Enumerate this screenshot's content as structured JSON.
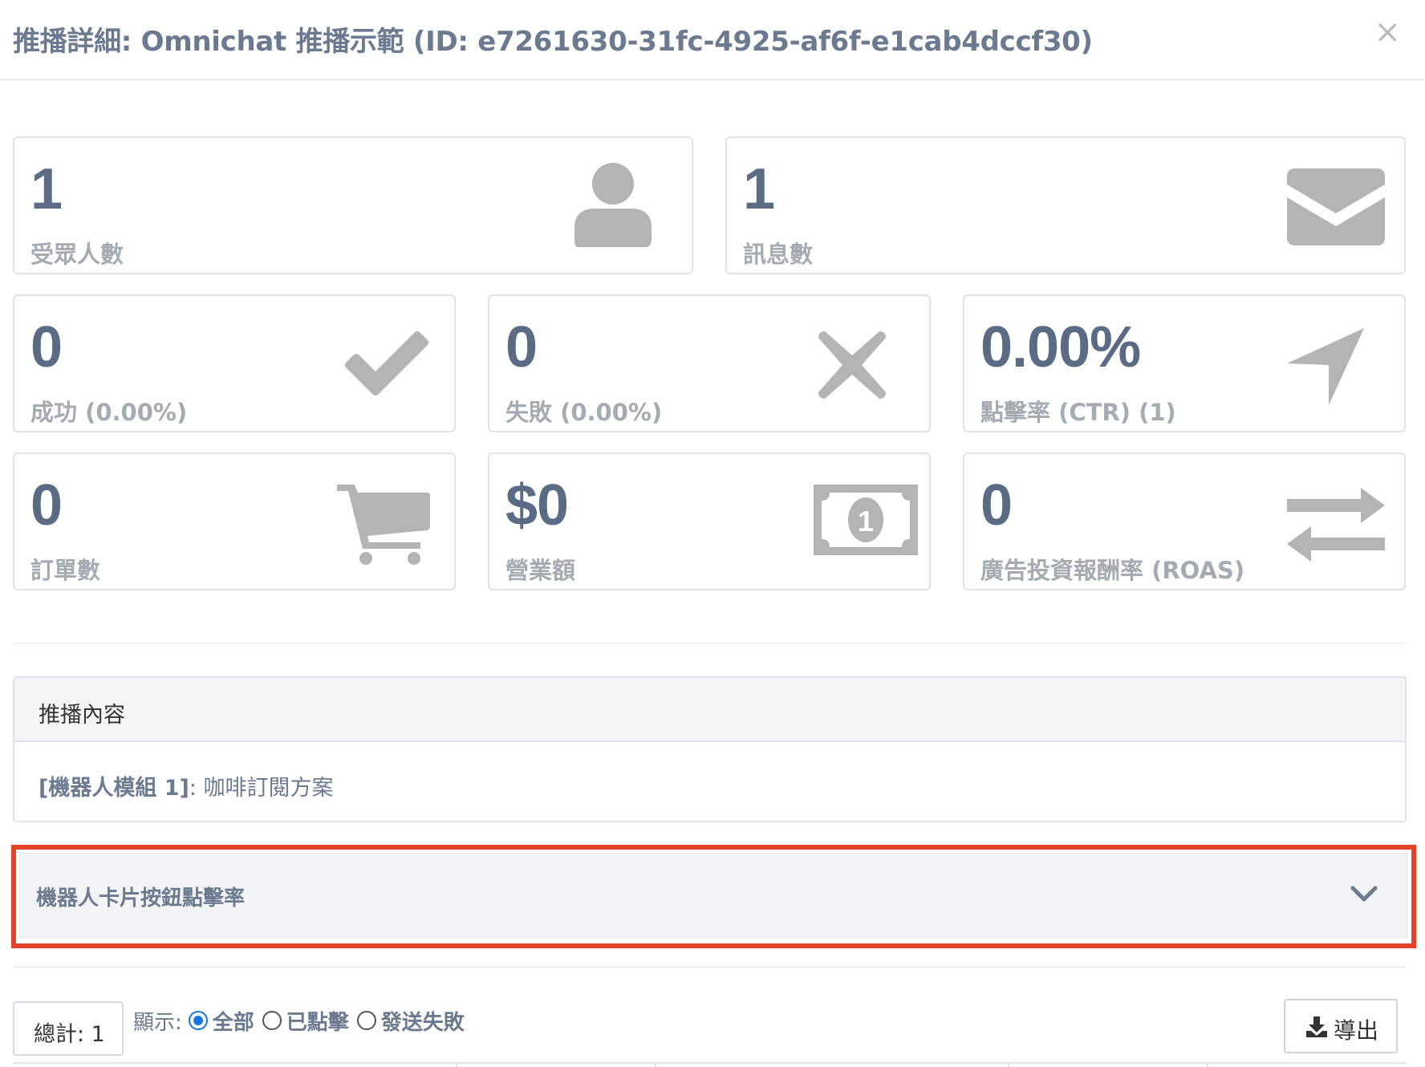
{
  "modal": {
    "title": "推播詳細: Omnichat 推播示範 (ID: e7261630-31fc-4925-af6f-e1cab4dccf30)",
    "close": "×"
  },
  "stats": {
    "audience": {
      "value": "1",
      "label": "受眾人數",
      "icon": "user-icon"
    },
    "messages": {
      "value": "1",
      "label": "訊息數",
      "icon": "envelope-icon"
    },
    "success": {
      "value": "0",
      "label": "成功 (0.00%)",
      "icon": "check-icon"
    },
    "failed": {
      "value": "0",
      "label": "失敗 (0.00%)",
      "icon": "x-icon"
    },
    "ctr": {
      "value": "0.00%",
      "label": "點擊率 (CTR) (1)",
      "icon": "send-arrow-icon"
    },
    "orders": {
      "value": "0",
      "label": "訂單數",
      "icon": "cart-icon"
    },
    "revenue": {
      "value": "$0",
      "label": "營業額",
      "icon": "money-bill-icon"
    },
    "roas": {
      "value": "0",
      "label": "廣告投資報酬率 (ROAS)",
      "icon": "exchange-icon"
    }
  },
  "content_panel": {
    "heading": "推播內容",
    "module": "[機器人模組 1]",
    "text": ": 咖啡訂閱方案"
  },
  "accordion": {
    "title": "機器人卡片按鈕點擊率"
  },
  "toolbar": {
    "total": "總計: 1",
    "filter_label": "顯示:",
    "options": [
      "全部",
      "已點擊",
      "發送失敗"
    ],
    "selected": "全部",
    "export_label": "導出"
  },
  "colors": {
    "highlight": "#e5422c",
    "radio_selected": "#1a73e8",
    "value_text": "#5b6b86",
    "icon_gray": "#b4b4b4"
  }
}
